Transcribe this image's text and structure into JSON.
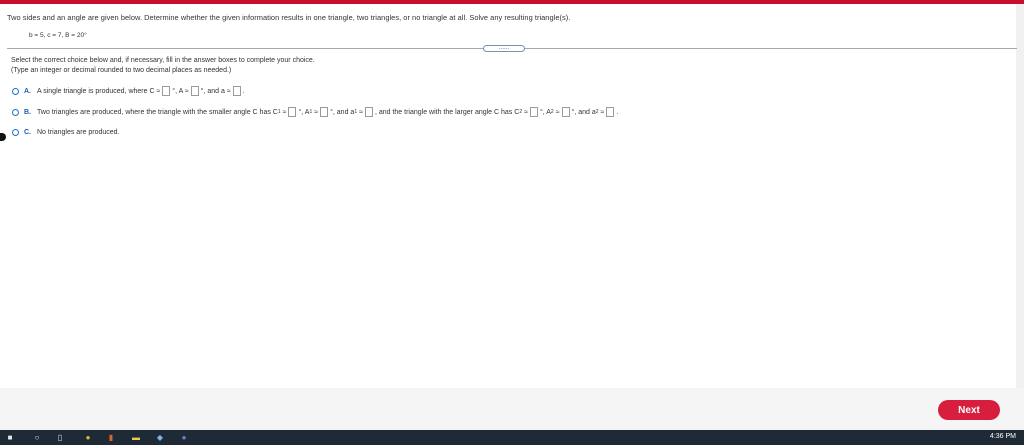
{
  "question": {
    "text": "Two sides and an angle are given below. Determine whether the given information results in one triangle, two triangles, or no triangle at all. Solve any resulting triangle(s).",
    "given": "b = 5, c = 7, B = 20°"
  },
  "expand_dots": "......",
  "instructions": {
    "line1": "Select the correct choice below and, if necessary, fill in the answer boxes to complete your choice.",
    "line2": "(Type an integer or decimal rounded to two decimal places as needed.)"
  },
  "options": {
    "a": {
      "letter": "A.",
      "text_before_c": "A single triangle is produced, where C ≈",
      "text_before_a_angle": "°, A ≈",
      "text_before_a_side": "°, and a ≈",
      "end": "."
    },
    "b": {
      "letter": "B.",
      "intro": "Two triangles are produced, where the triangle with the smaller angle C has C",
      "sub1": "1",
      "approx": "≈",
      "deg_comma": "°, A",
      "deg_and": "°, and a",
      "mid": ", and the triangle with the larger angle C has C",
      "sub2": "2",
      "end": "."
    },
    "c": {
      "letter": "C.",
      "text": "No triangles are produced."
    }
  },
  "next_button": "Next",
  "taskbar": {
    "clock": "4:36 PM",
    "icons": [
      "windows-icon",
      "search-icon",
      "task-view-icon",
      "chrome-icon",
      "office-icon",
      "file-explorer-icon",
      "photos-icon",
      "app-icon"
    ]
  },
  "colors": {
    "accent_red": "#c8102e",
    "next_button": "#d81e3f",
    "option_letter": "#1d5aa8",
    "radio_border": "#1d73c8",
    "taskbar": "#1f2a37"
  }
}
